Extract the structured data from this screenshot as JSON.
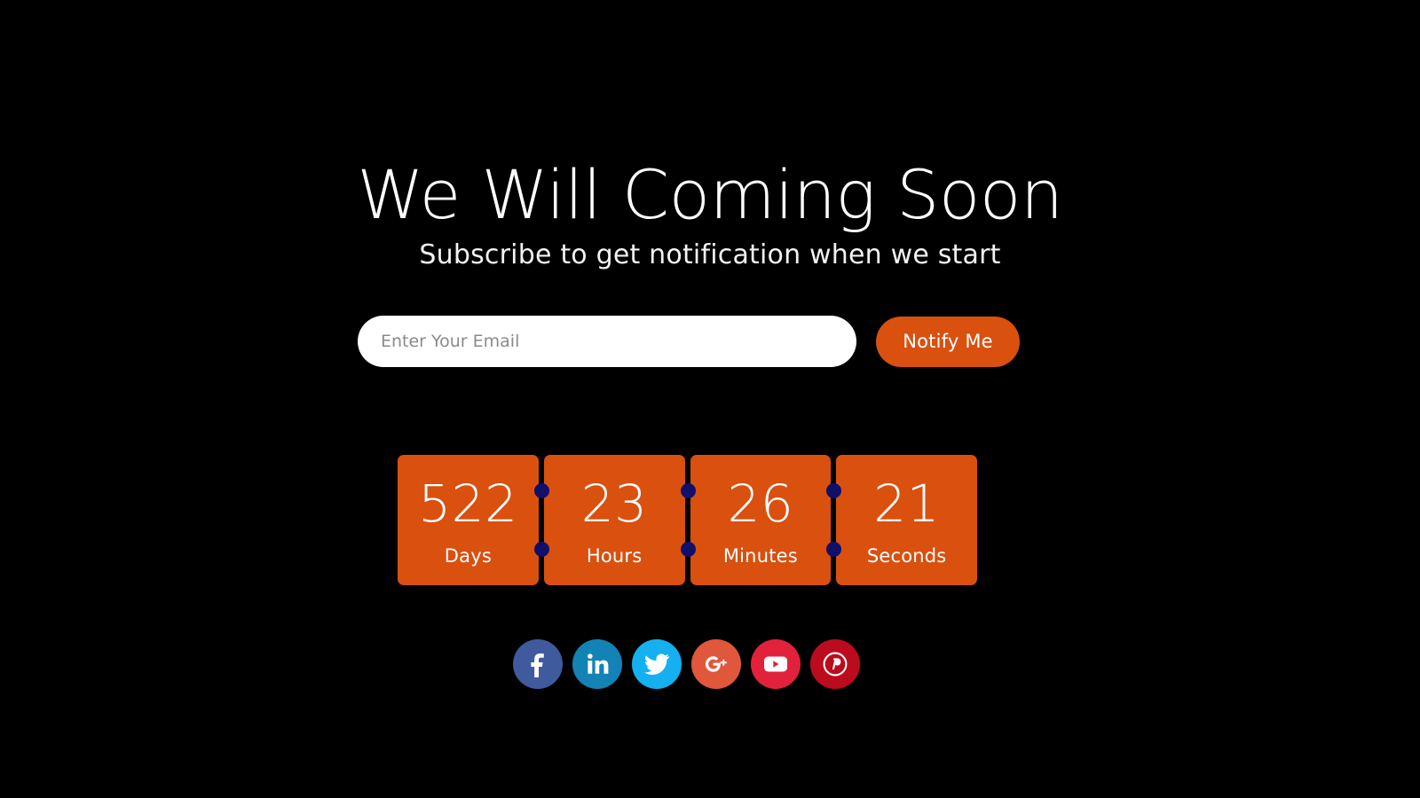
{
  "page": {
    "background_color": "#000000",
    "accent_color": "#d9500f",
    "dot_color": "#10106b"
  },
  "headline": "We Will Coming Soon",
  "subhead": "Subscribe to get notification when we start",
  "subscribe": {
    "email_placeholder": "Enter Your Email",
    "email_value": "",
    "notify_label": "Notify Me"
  },
  "countdown": [
    {
      "value": "522",
      "label": "Days"
    },
    {
      "value": "23",
      "label": "Hours"
    },
    {
      "value": "26",
      "label": "Minutes"
    },
    {
      "value": "21",
      "label": "Seconds"
    }
  ],
  "socials": [
    {
      "name": "facebook",
      "label": "Facebook",
      "color": "#3f5a9d"
    },
    {
      "name": "linkedin",
      "label": "LinkedIn",
      "color": "#1383b6"
    },
    {
      "name": "twitter",
      "label": "Twitter",
      "color": "#15b0ef"
    },
    {
      "name": "googleplus",
      "label": "Google Plus",
      "color": "#e0573c"
    },
    {
      "name": "youtube",
      "label": "YouTube",
      "color": "#e2223b"
    },
    {
      "name": "pinterest",
      "label": "Pinterest",
      "color": "#bd0b1e"
    }
  ]
}
